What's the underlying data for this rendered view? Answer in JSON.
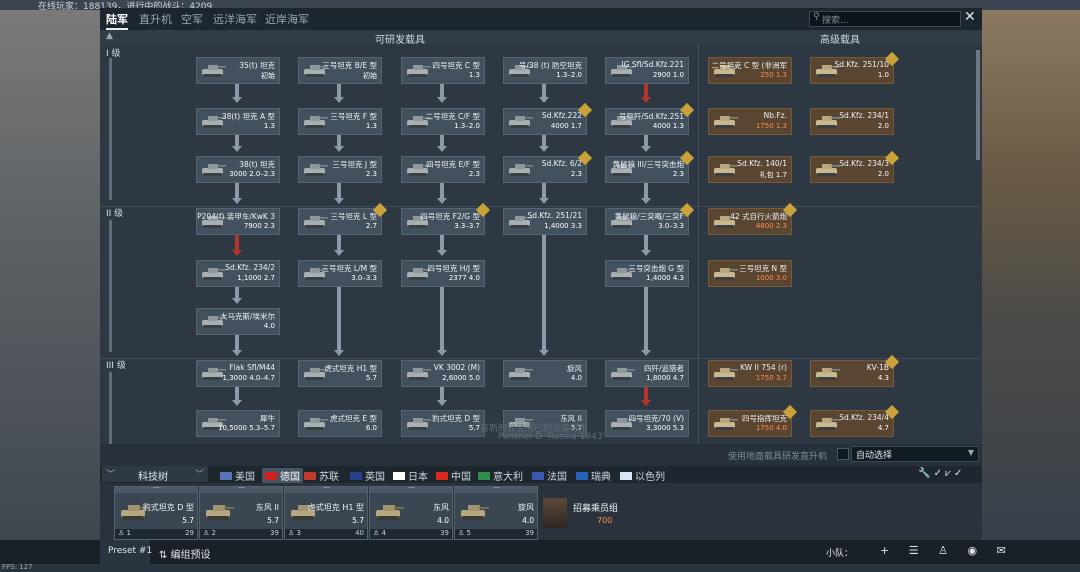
{
  "topline": "在线玩家：188139，进行中的战斗：4209",
  "tabs": [
    "陆军",
    "直升机",
    "空军",
    "远洋海军",
    "近岸海军"
  ],
  "search": {
    "placeholder": "搜索..."
  },
  "headers": {
    "researchable": "可研发载具",
    "premium": "高级载具"
  },
  "ranks": [
    "I 级",
    "II 级",
    "III 级"
  ],
  "cards": [
    {
      "name": "35(t) 坦克",
      "br": "初始",
      "prem": false
    },
    {
      "name": "三号坦克 B/E 型",
      "br": "初始",
      "prem": false
    },
    {
      "name": "四号坦克 C 型",
      "br": "1.3",
      "prem": false
    },
    {
      "name": "号/38 (t) 防空坦克",
      "br": "1.3–2.0",
      "prem": false
    },
    {
      "name": "IG Sfl/Sd.Kfz.221",
      "br": "2900 1.0",
      "prem": false
    },
    {
      "name": "38(t) 坦克 A 型",
      "br": "1.3",
      "prem": false
    },
    {
      "name": "三号坦克 F 型",
      "br": "1.3",
      "prem": false
    },
    {
      "name": "二号坦克 C/F 型",
      "br": "1.3–2.0",
      "prem": false
    },
    {
      "name": "Sd.Kfz.222",
      "br": "4000 1.7",
      "prem": false
    },
    {
      "name": "号驱歼/Sd.Kfz.251",
      "br": "4000 1.3",
      "prem": false
    },
    {
      "name": "38(t) 坦克",
      "br": "3000 2.0–2.3",
      "prem": false
    },
    {
      "name": "三号坦克 J 型",
      "br": "2.3",
      "prem": false
    },
    {
      "name": "四号坦克 E/F 型",
      "br": "2.3",
      "prem": false
    },
    {
      "name": "Sd.Kfz. 6/2",
      "br": "2.3",
      "prem": false
    },
    {
      "name": "黄鼠狼 III/三号突击炮",
      "br": "2.3",
      "prem": false
    },
    {
      "name": "P204(f) 装甲车/KwK 3",
      "br": "7900 2.3",
      "prem": false
    },
    {
      "name": "三号坦克 L 型",
      "br": "2.7",
      "prem": false
    },
    {
      "name": "四号坦克 F2/G 型",
      "br": "3.3–3.7",
      "prem": false
    },
    {
      "name": "Sd.Kfz. 251/21",
      "br": "1,4000 3.3",
      "prem": false
    },
    {
      "name": "黄鼠狼/三突嘅/三突F",
      "br": "3.0–3.3",
      "prem": false
    },
    {
      "name": "Sd.Kfz. 234/2",
      "br": "1,1000 2.7",
      "prem": false
    },
    {
      "name": "三号坦克 L/M 型",
      "br": "3.0–3.3",
      "prem": false
    },
    {
      "name": "四号坦克 H/J 型",
      "br": "2377 4.0",
      "prem": false
    },
    {
      "name": "三号突击炮 G 型",
      "br": "1,4000 4.3",
      "prem": false
    },
    {
      "name": "大马克斯/埃米尔",
      "br": "4.0",
      "prem": false
    },
    {
      "name": "Flak Sfl/M44",
      "br": "1,3000 4.0–4.7",
      "prem": false
    },
    {
      "name": "虎式坦克 H1 型",
      "br": "5.7",
      "prem": false
    },
    {
      "name": "VK 3002 (M)",
      "br": "2,6000 5.0",
      "prem": false
    },
    {
      "name": "旋风",
      "br": "4.0",
      "prem": false
    },
    {
      "name": "四歼/追猎者",
      "br": "1,8000 4.7",
      "prem": false
    },
    {
      "name": "犀牛",
      "br": "10,5000 5.3–5.7",
      "prem": false
    },
    {
      "name": "虎式坦克 E 型",
      "br": "6.0",
      "prem": false
    },
    {
      "name": "豹式坦克 D 型",
      "br": "5.7",
      "prem": false
    },
    {
      "name": "东风 II",
      "br": "5.7",
      "prem": false
    },
    {
      "name": "四号坦克/70 (V)",
      "br": "3,3000 5.3",
      "prem": false
    },
    {
      "name": "二号坦克 C 型 (非洲军",
      "br": "250 1.3",
      "prem": true
    },
    {
      "name": "Sd.Kfz. 251/10",
      "br": "1.0",
      "prem": true
    },
    {
      "name": "Nb.Fz.",
      "br": "1750 1.3",
      "prem": true
    },
    {
      "name": "Sd.Kfz. 234/1",
      "br": "2.0",
      "prem": true
    },
    {
      "name": "Sd.Kfz. 140/1",
      "br": "礼包 1.7",
      "prem": true
    },
    {
      "name": "Sd.Kfz. 234/3",
      "br": "2.0",
      "prem": true
    },
    {
      "name": "42 式自行火箭炮",
      "br": "4800 2.3",
      "prem": true
    },
    {
      "name": "三号坦克 N 型",
      "br": "1000 3.0",
      "prem": true
    },
    {
      "name": "KW II 754 (r)",
      "br": "1750 3.7",
      "prem": true
    },
    {
      "name": "KV-1B",
      "br": "4.3",
      "prem": true
    },
    {
      "name": "四号指挥坦克",
      "br": "1750 4.0",
      "prem": true
    },
    {
      "name": "Sd.Kfz. 234/4",
      "br": "4.7",
      "prem": true
    }
  ],
  "watermark": {
    "line1": "有新的涂装刷已的涂装可用",
    "line2": "Panther D 'Russia 1943'"
  },
  "research_label": "使用地面载具研发直升机",
  "auto_select": "自动选择",
  "tech_tree": "科技树",
  "nations": [
    "美国",
    "德国",
    "苏联",
    "英国",
    "日本",
    "中国",
    "意大利",
    "法国",
    "瑞典",
    "以色列"
  ],
  "crew_slots": [
    {
      "name": "豹式坦克 D 型",
      "br": "5.7",
      "num": "1",
      "crew": "29"
    },
    {
      "name": "东风 II",
      "br": "5.7",
      "num": "2",
      "crew": "39"
    },
    {
      "name": "虎式坦克 H1 型",
      "br": "5.7",
      "num": "3",
      "crew": "40"
    },
    {
      "name": "东风",
      "br": "4.0",
      "num": "4",
      "crew": "39"
    },
    {
      "name": "旋风",
      "br": "4.0",
      "num": "5",
      "crew": "39"
    }
  ],
  "recruit": {
    "label": "招募乘员组",
    "price": "700"
  },
  "footer": {
    "preset": "Preset #1",
    "edit_preset": "编组预设",
    "squad": "小队："
  },
  "fps": "FPS: 127",
  "colors": {
    "premium_bg": "#5a4530",
    "research_bg": "#43515e",
    "lock_red": "#b3362c"
  }
}
